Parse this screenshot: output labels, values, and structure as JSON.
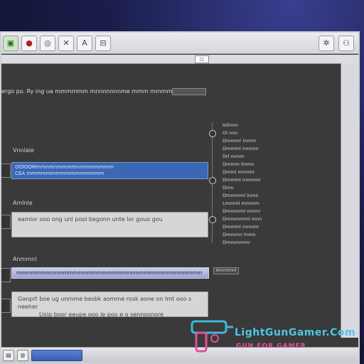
{
  "toolbar": {
    "buttons": [
      {
        "icon": "monitor-icon",
        "glyph": "▣"
      },
      {
        "icon": "stop-icon",
        "glyph": "●"
      },
      {
        "icon": "globe-icon",
        "glyph": "◎"
      },
      {
        "icon": "tools-icon",
        "glyph": "✕"
      },
      {
        "icon": "font-icon",
        "glyph": "A"
      },
      {
        "icon": "save-icon",
        "glyph": "⊟"
      }
    ],
    "right_buttons": [
      {
        "icon": "gear-icon",
        "glyph": "✲"
      },
      {
        "icon": "users-icon",
        "glyph": "⚇"
      }
    ],
    "path_value": "□"
  },
  "main": {
    "heading": "ergo po. Ry ing ua mmmmmm mnnnnnnnme mmm mmmms (m)",
    "section1_label": "Vnnlale",
    "selected_item": {
      "line1": "OOlOOMmmnmnmmmmnmmmmmmm",
      "line2": "CEA mmmmmmmmmmmmmmmm"
    },
    "section2_label": "Amlnle",
    "text_box1": "eamlor ooo ong unl pool begonn unte lor gouo gou",
    "section3_label": "Anmmnl",
    "input_row": "mmmmmmmnmmmmmmmmmmmmmmmmnmmmmmmmmmmmmmm",
    "side_button": "Annmmnl",
    "text_box2_line1": "Ganprt boe ug unmme besbk aomme rosk aone on Imt ooo s neeher",
    "text_box2_line2": "Llsip boor eeupe ooo le poo e o sennoonore"
  },
  "tree": [
    "Iollnnn",
    "Ol nnn",
    "Dmmmr lnmnr",
    "Dmmml mnnnn",
    "Drl mmm",
    "Dmmm lmmn",
    "Dmml mnnmr",
    "Dmmml mmnmr",
    "Dmn",
    "Dmmmml lnmn",
    "Lmmml mmmm",
    "Dmmmml mmnr",
    "Dmmmmml mnn",
    "Dmmml mnnmr",
    "Dmmmn lnmn",
    "Dmmmmmr"
  ],
  "taskbar": {
    "icons": [
      {
        "icon": "desktop-icon",
        "glyph": "▤"
      },
      {
        "icon": "globe-icon",
        "glyph": "◍"
      }
    ]
  },
  "watermark": {
    "brand": "LightGunGamer.Com",
    "tagline": "GUN FOR GAMER"
  }
}
